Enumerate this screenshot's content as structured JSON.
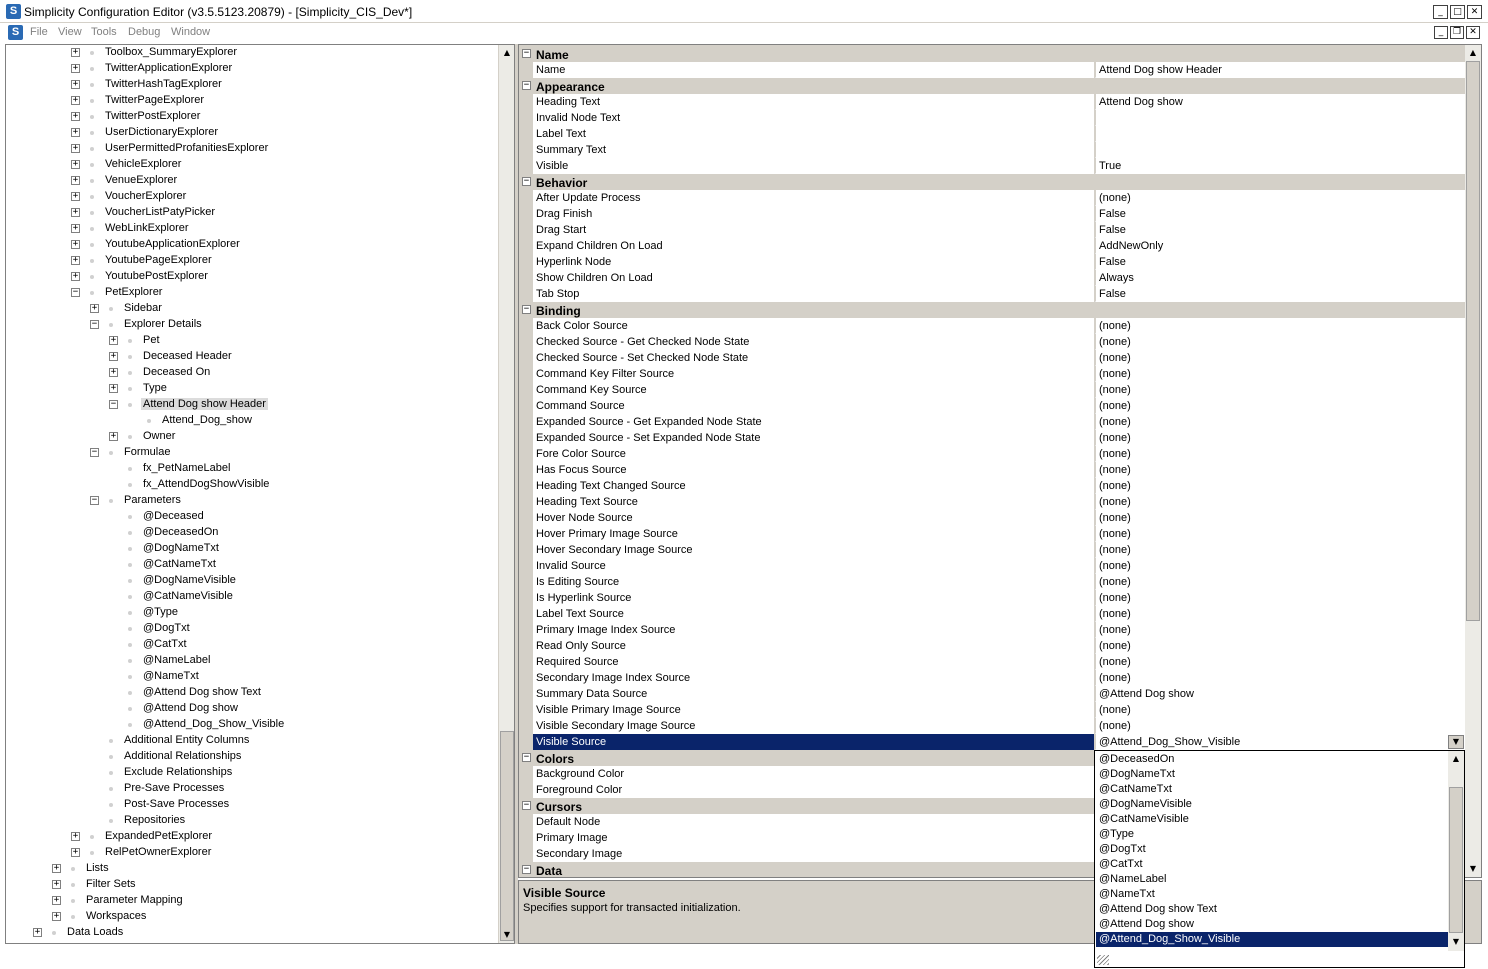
{
  "window": {
    "title": "Simplicity Configuration Editor (v3.5.5123.20879) - [Simplicity_CIS_Dev*]",
    "app_icon": "S",
    "controls": [
      "_",
      "□",
      "✕"
    ]
  },
  "menu": {
    "items": [
      "File",
      "View",
      "Tools",
      "Debug",
      "Window"
    ],
    "mdi_controls": [
      "_",
      "❐",
      "✕"
    ]
  },
  "tree": {
    "items": [
      {
        "label": "Toolbox_SummaryExplorer",
        "level": 3,
        "state": "collapsed"
      },
      {
        "label": "TwitterApplicationExplorer",
        "level": 3,
        "state": "collapsed"
      },
      {
        "label": "TwitterHashTagExplorer",
        "level": 3,
        "state": "collapsed"
      },
      {
        "label": "TwitterPageExplorer",
        "level": 3,
        "state": "collapsed"
      },
      {
        "label": "TwitterPostExplorer",
        "level": 3,
        "state": "collapsed"
      },
      {
        "label": "UserDictionaryExplorer",
        "level": 3,
        "state": "collapsed"
      },
      {
        "label": "UserPermittedProfanitiesExplorer",
        "level": 3,
        "state": "collapsed"
      },
      {
        "label": "VehicleExplorer",
        "level": 3,
        "state": "collapsed"
      },
      {
        "label": "VenueExplorer",
        "level": 3,
        "state": "collapsed"
      },
      {
        "label": "VoucherExplorer",
        "level": 3,
        "state": "collapsed"
      },
      {
        "label": "VoucherListPatyPicker",
        "level": 3,
        "state": "collapsed"
      },
      {
        "label": "WebLinkExplorer",
        "level": 3,
        "state": "collapsed"
      },
      {
        "label": "YoutubeApplicationExplorer",
        "level": 3,
        "state": "collapsed"
      },
      {
        "label": "YoutubePageExplorer",
        "level": 3,
        "state": "collapsed"
      },
      {
        "label": "YoutubePostExplorer",
        "level": 3,
        "state": "collapsed"
      },
      {
        "label": "PetExplorer",
        "level": 3,
        "state": "expanded"
      },
      {
        "label": "Sidebar",
        "level": 4,
        "state": "collapsed"
      },
      {
        "label": "Explorer Details",
        "level": 4,
        "state": "expanded"
      },
      {
        "label": "Pet",
        "level": 5,
        "state": "collapsed"
      },
      {
        "label": "Deceased Header",
        "level": 5,
        "state": "collapsed"
      },
      {
        "label": "Deceased On",
        "level": 5,
        "state": "collapsed"
      },
      {
        "label": "Type",
        "level": 5,
        "state": "collapsed"
      },
      {
        "label": "Attend Dog show Header",
        "level": 5,
        "state": "expanded",
        "selected": true
      },
      {
        "label": "Attend_Dog_show",
        "level": 6,
        "state": "leaf"
      },
      {
        "label": "Owner",
        "level": 5,
        "state": "collapsed"
      },
      {
        "label": "Formulae",
        "level": 4,
        "state": "expanded"
      },
      {
        "label": "fx_PetNameLabel",
        "level": 5,
        "state": "leaf"
      },
      {
        "label": "fx_AttendDogShowVisible",
        "level": 5,
        "state": "leaf"
      },
      {
        "label": "Parameters",
        "level": 4,
        "state": "expanded"
      },
      {
        "label": "@Deceased",
        "level": 5,
        "state": "leaf"
      },
      {
        "label": "@DeceasedOn",
        "level": 5,
        "state": "leaf"
      },
      {
        "label": "@DogNameTxt",
        "level": 5,
        "state": "leaf"
      },
      {
        "label": "@CatNameTxt",
        "level": 5,
        "state": "leaf"
      },
      {
        "label": "@DogNameVisible",
        "level": 5,
        "state": "leaf"
      },
      {
        "label": "@CatNameVisible",
        "level": 5,
        "state": "leaf"
      },
      {
        "label": "@Type",
        "level": 5,
        "state": "leaf"
      },
      {
        "label": "@DogTxt",
        "level": 5,
        "state": "leaf"
      },
      {
        "label": "@CatTxt",
        "level": 5,
        "state": "leaf"
      },
      {
        "label": "@NameLabel",
        "level": 5,
        "state": "leaf"
      },
      {
        "label": "@NameTxt",
        "level": 5,
        "state": "leaf"
      },
      {
        "label": "@Attend Dog show Text",
        "level": 5,
        "state": "leaf"
      },
      {
        "label": "@Attend Dog show",
        "level": 5,
        "state": "leaf"
      },
      {
        "label": "@Attend_Dog_Show_Visible",
        "level": 5,
        "state": "leaf"
      },
      {
        "label": "Additional Entity Columns",
        "level": 4,
        "state": "leaf"
      },
      {
        "label": "Additional Relationships",
        "level": 4,
        "state": "leaf"
      },
      {
        "label": "Exclude Relationships",
        "level": 4,
        "state": "leaf"
      },
      {
        "label": "Pre-Save Processes",
        "level": 4,
        "state": "leaf"
      },
      {
        "label": "Post-Save Processes",
        "level": 4,
        "state": "leaf"
      },
      {
        "label": "Repositories",
        "level": 4,
        "state": "leaf"
      },
      {
        "label": "ExpandedPetExplorer",
        "level": 3,
        "state": "collapsed"
      },
      {
        "label": "RelPetOwnerExplorer",
        "level": 3,
        "state": "collapsed"
      },
      {
        "label": "Lists",
        "level": 2,
        "state": "collapsed"
      },
      {
        "label": "Filter Sets",
        "level": 2,
        "state": "collapsed"
      },
      {
        "label": "Parameter Mapping",
        "level": 2,
        "state": "collapsed"
      },
      {
        "label": "Workspaces",
        "level": 2,
        "state": "collapsed"
      },
      {
        "label": "Data Loads",
        "level": 1,
        "state": "collapsed"
      }
    ]
  },
  "grid": {
    "rows": [
      {
        "type": "category",
        "title": "Name"
      },
      {
        "type": "prop",
        "name": "Name",
        "value": "Attend Dog show Header"
      },
      {
        "type": "category",
        "title": "Appearance"
      },
      {
        "type": "prop",
        "name": "Heading Text",
        "value": "Attend Dog show"
      },
      {
        "type": "prop",
        "name": "Invalid Node Text",
        "value": ""
      },
      {
        "type": "prop",
        "name": "Label Text",
        "value": ""
      },
      {
        "type": "prop",
        "name": "Summary Text",
        "value": ""
      },
      {
        "type": "prop",
        "name": "Visible",
        "value": "True"
      },
      {
        "type": "category",
        "title": "Behavior"
      },
      {
        "type": "prop",
        "name": "After Update Process",
        "value": "(none)"
      },
      {
        "type": "prop",
        "name": "Drag Finish",
        "value": "False"
      },
      {
        "type": "prop",
        "name": "Drag Start",
        "value": "False"
      },
      {
        "type": "prop",
        "name": "Expand Children On Load",
        "value": "AddNewOnly"
      },
      {
        "type": "prop",
        "name": "Hyperlink Node",
        "value": "False"
      },
      {
        "type": "prop",
        "name": "Show Children On Load",
        "value": "Always"
      },
      {
        "type": "prop",
        "name": "Tab Stop",
        "value": "False"
      },
      {
        "type": "category",
        "title": "Binding"
      },
      {
        "type": "prop",
        "name": "Back Color Source",
        "value": "(none)"
      },
      {
        "type": "prop",
        "name": "Checked Source - Get Checked Node State",
        "value": "(none)"
      },
      {
        "type": "prop",
        "name": "Checked Source - Set Checked Node State",
        "value": "(none)"
      },
      {
        "type": "prop",
        "name": "Command Key Filter Source",
        "value": "(none)"
      },
      {
        "type": "prop",
        "name": "Command Key Source",
        "value": "(none)"
      },
      {
        "type": "prop",
        "name": "Command Source",
        "value": "(none)"
      },
      {
        "type": "prop",
        "name": "Expanded Source - Get Expanded Node State",
        "value": "(none)"
      },
      {
        "type": "prop",
        "name": "Expanded Source - Set Expanded Node State",
        "value": "(none)"
      },
      {
        "type": "prop",
        "name": "Fore Color Source",
        "value": "(none)"
      },
      {
        "type": "prop",
        "name": "Has Focus Source",
        "value": "(none)"
      },
      {
        "type": "prop",
        "name": "Heading Text Changed Source",
        "value": "(none)"
      },
      {
        "type": "prop",
        "name": "Heading Text Source",
        "value": "(none)"
      },
      {
        "type": "prop",
        "name": "Hover Node Source",
        "value": "(none)"
      },
      {
        "type": "prop",
        "name": "Hover Primary Image Source",
        "value": "(none)"
      },
      {
        "type": "prop",
        "name": "Hover Secondary Image Source",
        "value": "(none)"
      },
      {
        "type": "prop",
        "name": "Invalid Source",
        "value": "(none)"
      },
      {
        "type": "prop",
        "name": "Is Editing Source",
        "value": "(none)"
      },
      {
        "type": "prop",
        "name": "Is Hyperlink Source",
        "value": "(none)"
      },
      {
        "type": "prop",
        "name": "Label Text Source",
        "value": "(none)"
      },
      {
        "type": "prop",
        "name": "Primary Image Index Source",
        "value": "(none)"
      },
      {
        "type": "prop",
        "name": "Read Only Source",
        "value": "(none)"
      },
      {
        "type": "prop",
        "name": "Required Source",
        "value": "(none)"
      },
      {
        "type": "prop",
        "name": "Secondary Image Index Source",
        "value": "(none)"
      },
      {
        "type": "prop",
        "name": "Summary Data Source",
        "value": "@Attend Dog show"
      },
      {
        "type": "prop",
        "name": "Visible Primary Image Source",
        "value": "(none)"
      },
      {
        "type": "prop",
        "name": "Visible Secondary Image Source",
        "value": "(none)"
      },
      {
        "type": "prop",
        "name": "Visible Source",
        "value": "@Attend_Dog_Show_Visible",
        "selected": true
      },
      {
        "type": "category",
        "title": "Colors"
      },
      {
        "type": "prop",
        "name": "Background Color",
        "value": ""
      },
      {
        "type": "prop",
        "name": "Foreground Color",
        "value": ""
      },
      {
        "type": "category",
        "title": "Cursors"
      },
      {
        "type": "prop",
        "name": "Default Node",
        "value": ""
      },
      {
        "type": "prop",
        "name": "Primary Image",
        "value": ""
      },
      {
        "type": "prop",
        "name": "Secondary Image",
        "value": ""
      },
      {
        "type": "category",
        "title": "Data"
      }
    ]
  },
  "description": {
    "title": "Visible Source",
    "text": "Specifies support for transacted initialization."
  },
  "dropdown": {
    "options": [
      "@DeceasedOn",
      "@DogNameTxt",
      "@CatNameTxt",
      "@DogNameVisible",
      "@CatNameVisible",
      "@Type",
      "@DogTxt",
      "@CatTxt",
      "@NameLabel",
      "@NameTxt",
      "@Attend Dog show Text",
      "@Attend Dog show",
      "@Attend_Dog_Show_Visible"
    ],
    "selected": "@Attend_Dog_Show_Visible"
  },
  "colors": {
    "selection": "#0a246a",
    "category": "#d4d0c8",
    "accent": "#2a6ab4"
  }
}
